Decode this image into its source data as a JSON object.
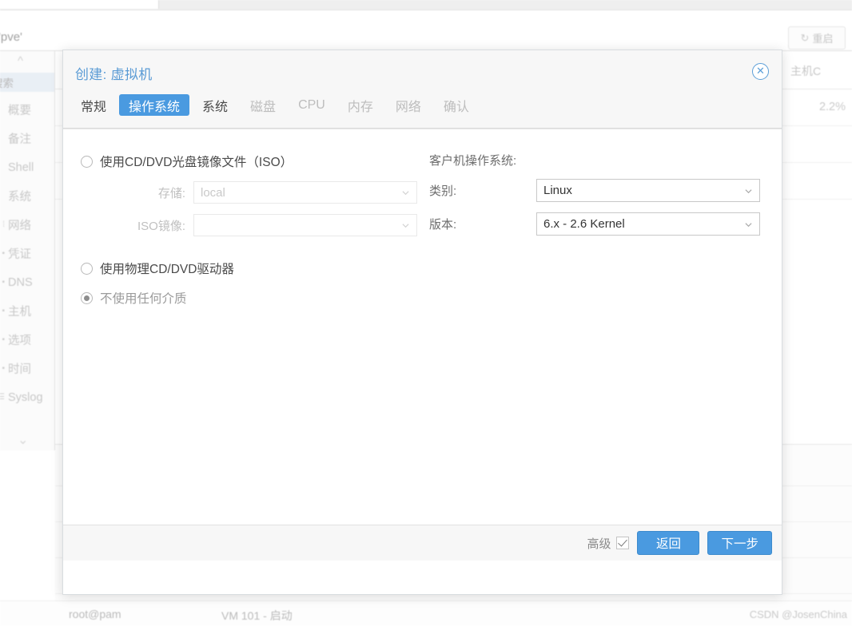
{
  "background": {
    "header": {
      "node_title": "'pve'",
      "restart_label": "重启",
      "restart_icon": "refresh-icon"
    },
    "sidebar": {
      "search_placeholder": "搜索",
      "items": [
        {
          "label": "概要",
          "icon": ""
        },
        {
          "label": "备注",
          "icon": ""
        },
        {
          "label": "Shell",
          "icon": ""
        },
        {
          "label": "系统",
          "icon": ""
        },
        {
          "label": "网络",
          "icon": "⁞"
        },
        {
          "label": "凭证",
          "icon": "▪"
        },
        {
          "label": "DNS",
          "icon": "▪"
        },
        {
          "label": "主机",
          "icon": "▪"
        },
        {
          "label": "选项",
          "icon": "▪"
        },
        {
          "label": "时间",
          "icon": "▪"
        },
        {
          "label": "Syslog",
          "icon": "☰"
        }
      ]
    },
    "table": {
      "column_header": "主机C",
      "cell_value": "2.2%"
    },
    "statusbar": {
      "user": "root@pam",
      "task": "VM 101 - 启动",
      "watermark": "CSDN @JosenChina"
    }
  },
  "dialog": {
    "title": "创建: 虚拟机",
    "close_icon": "close-icon",
    "tabs": [
      {
        "label": "常规",
        "state": "normal"
      },
      {
        "label": "操作系统",
        "state": "active"
      },
      {
        "label": "系统",
        "state": "normal"
      },
      {
        "label": "磁盘",
        "state": "disabled"
      },
      {
        "label": "CPU",
        "state": "disabled"
      },
      {
        "label": "内存",
        "state": "disabled"
      },
      {
        "label": "网络",
        "state": "disabled"
      },
      {
        "label": "确认",
        "state": "disabled"
      }
    ],
    "media": {
      "iso_radio_label": "使用CD/DVD光盘镜像文件（ISO）",
      "iso_radio_checked": false,
      "storage_label": "存储:",
      "storage_value": "local",
      "storage_enabled": false,
      "iso_image_label": "ISO镜像:",
      "iso_image_value": "",
      "iso_image_enabled": false,
      "physical_radio_label": "使用物理CD/DVD驱动器",
      "physical_radio_checked": false,
      "none_radio_label": "不使用任何介质",
      "none_radio_checked": true
    },
    "guest_os": {
      "section_title": "客户机操作系统:",
      "type_label": "类别:",
      "type_value": "Linux",
      "version_label": "版本:",
      "version_value": "6.x - 2.6 Kernel"
    },
    "footer": {
      "advanced_label": "高级",
      "advanced_checked": true,
      "back_label": "返回",
      "next_label": "下一步",
      "accent_color": "#4a9ae0"
    }
  }
}
